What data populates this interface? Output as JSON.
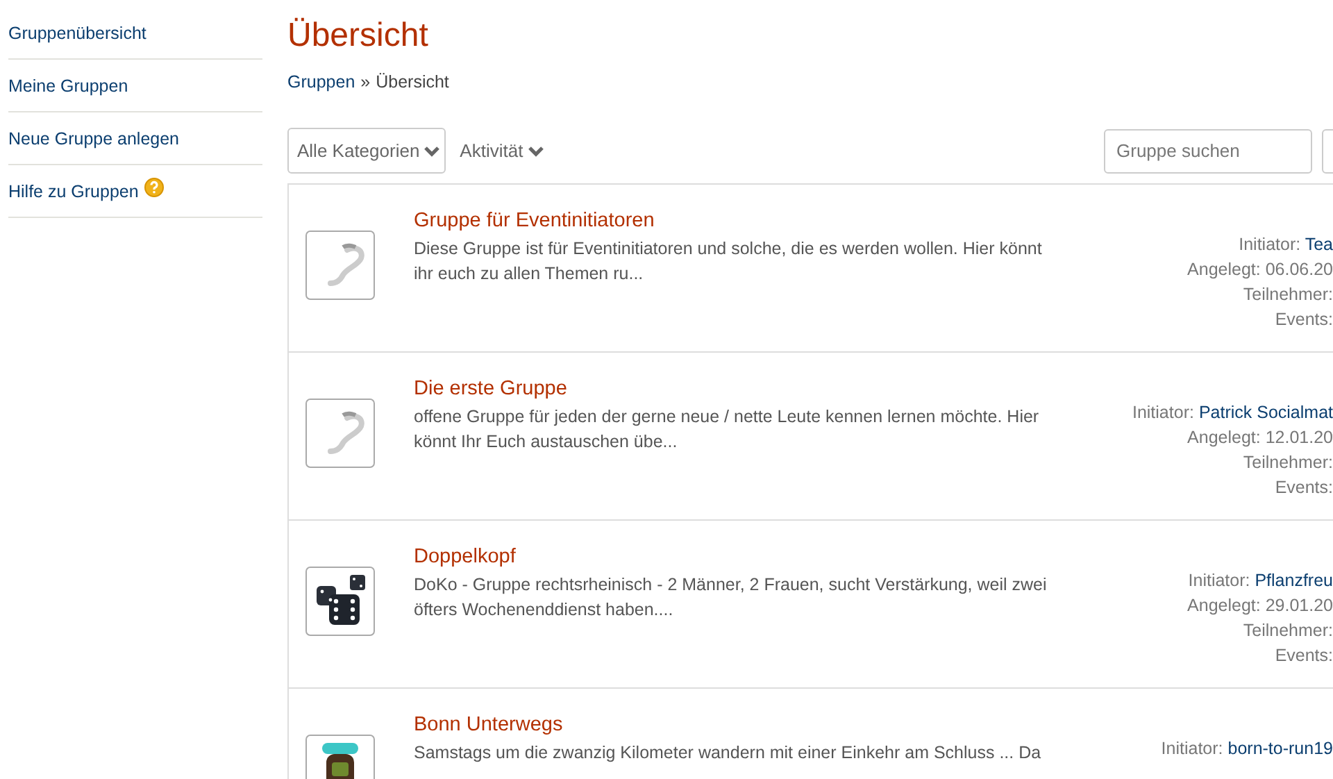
{
  "sidebar": {
    "items": [
      {
        "label": "Gruppenübersicht",
        "kind": "link"
      },
      {
        "label": "Meine Gruppen",
        "kind": "link"
      },
      {
        "label": "Neue Gruppe anlegen",
        "kind": "link"
      },
      {
        "label": "Hilfe zu Gruppen",
        "kind": "help"
      }
    ]
  },
  "page_title": "Übersicht",
  "breadcrumb": {
    "link": "Gruppen",
    "separator": "»",
    "current": "Übersicht"
  },
  "filters": {
    "category": "Alle Kategorien",
    "sort": "Aktivität",
    "search": {
      "placeholder": "Gruppe suchen"
    }
  },
  "groups": [
    {
      "kind": "placeholder",
      "title": "Gruppe für Eventinitiatoren",
      "description": "Diese Gruppe ist für Eventinitiatoren und solche, die es werden wollen. Hier könnt ihr euch zu allen Themen ru...",
      "initiator_label": "Initiator:",
      "initiator": "Tea",
      "meta": [
        "Angelegt: 06.06.20",
        "Teilnehmer:",
        "Events:"
      ]
    },
    {
      "kind": "placeholder",
      "title": "Die erste Gruppe",
      "description": "offene Gruppe für jeden der gerne neue / nette Leute kennen lernen möchte. Hier könnt Ihr Euch austauschen übe...",
      "initiator_label": "Initiator:",
      "initiator": "Patrick Socialmat",
      "meta": [
        "Angelegt: 12.01.20",
        "Teilnehmer:",
        "Events:"
      ]
    },
    {
      "kind": "dice",
      "title": "Doppelkopf",
      "description": "DoKo - Gruppe rechtsrheinisch - 2 Männer, 2 Frauen, sucht Verstärkung, weil zwei öfters Wochenenddienst haben....",
      "initiator_label": "Initiator:",
      "initiator": "Pflanzfreu",
      "meta": [
        "Angelegt: 29.01.20",
        "Teilnehmer:",
        "Events:"
      ]
    },
    {
      "kind": "backpack",
      "title": "Bonn Unterwegs",
      "description": "Samstags um die zwanzig Kilometer wandern mit einer Einkehr am Schluss ... Da",
      "initiator_label": "Initiator:",
      "initiator": "born-to-run19"
    }
  ]
}
